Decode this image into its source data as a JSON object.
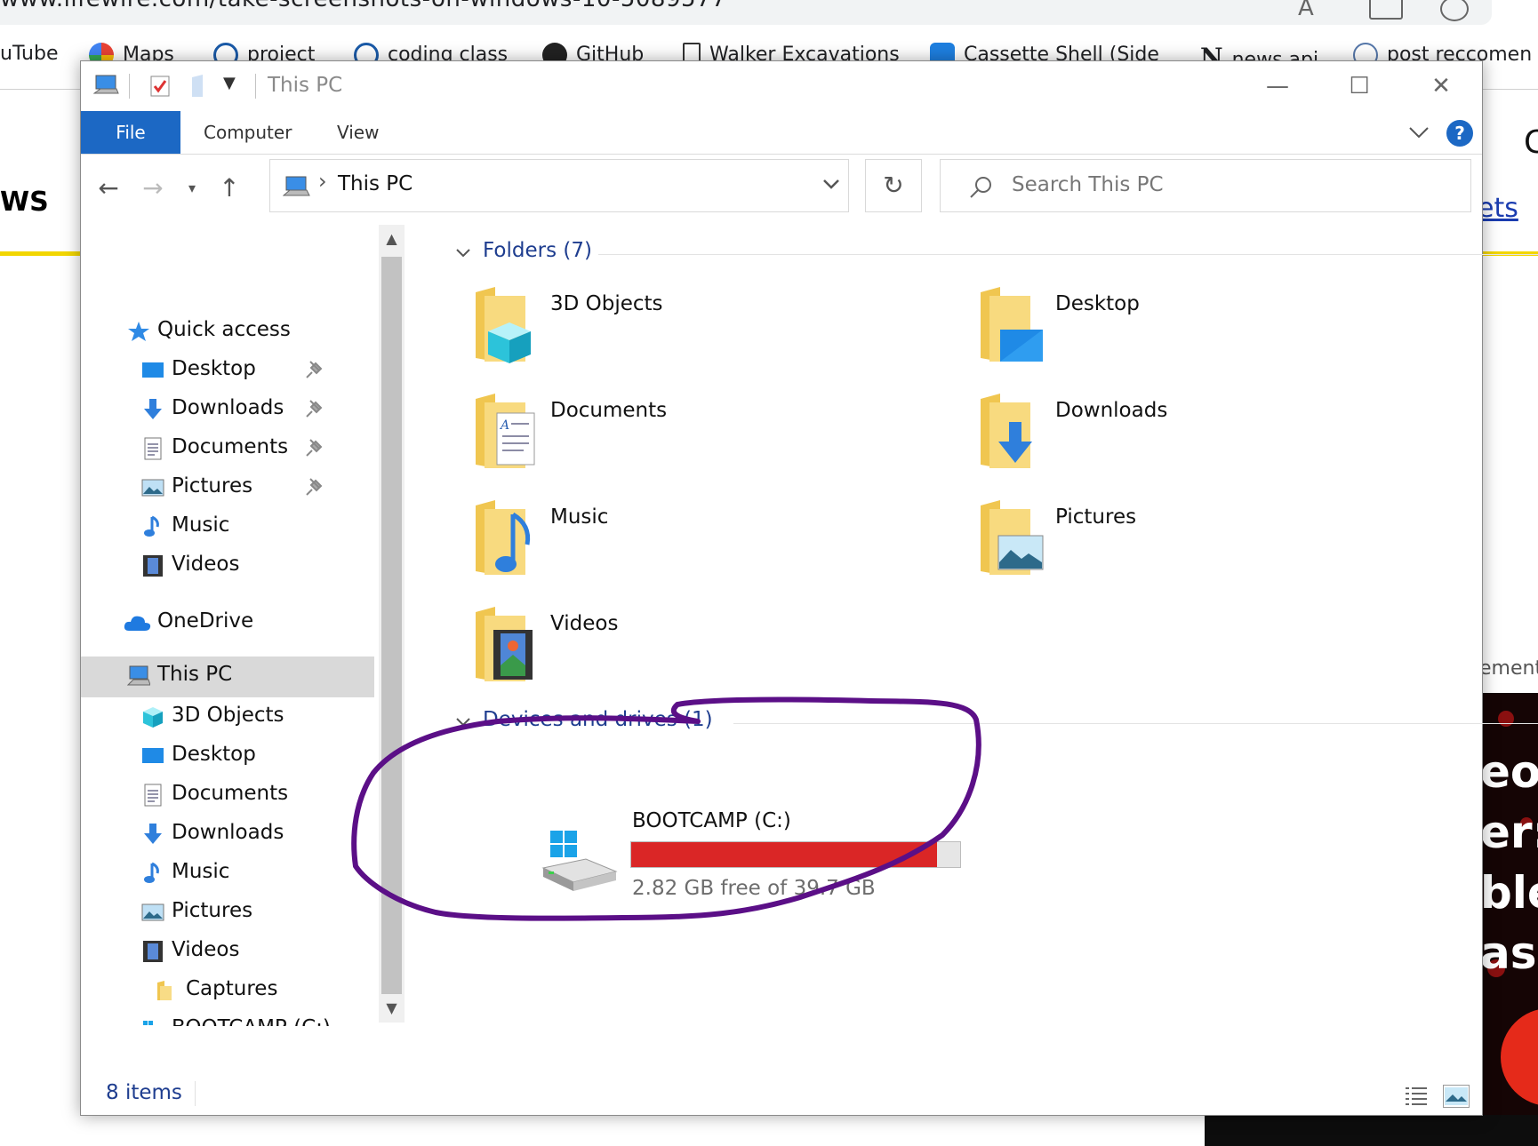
{
  "browser": {
    "url": "www.lifewire.com/take-screenshots-on-windows-10-5089577",
    "bookmarks": [
      "uTube",
      "Maps",
      "project",
      "coding class",
      "GitHub",
      "Walker Excavations",
      "Cassette Shell (Side",
      "news api",
      "post reccomen"
    ],
    "page_fragments": {
      "left_heading": "WS",
      "right_link": "ets",
      "right_letter": "C",
      "ad_label": "ement",
      "thumb_lines": [
        "eo",
        "er:",
        "ble",
        "asp"
      ]
    }
  },
  "explorer": {
    "title": "This PC",
    "ribbon_tabs": {
      "file": "File",
      "computer": "Computer",
      "view": "View"
    },
    "help_label": "?",
    "address": {
      "location": "This PC"
    },
    "search": {
      "placeholder": "Search This PC"
    },
    "nav": {
      "quick_access": "Quick access",
      "quick_items": [
        "Desktop",
        "Downloads",
        "Documents",
        "Pictures",
        "Music",
        "Videos"
      ],
      "onedrive": "OneDrive",
      "this_pc": "This PC",
      "pc_items": [
        "3D Objects",
        "Desktop",
        "Documents",
        "Downloads",
        "Music",
        "Pictures",
        "Videos",
        "Captures",
        "BOOTCAMP (C:)"
      ]
    },
    "folders_group": "Folders (7)",
    "folders": [
      "3D Objects",
      "Desktop",
      "Documents",
      "Downloads",
      "Music",
      "Pictures",
      "Videos"
    ],
    "devices_group": "Devices and drives (1)",
    "drive": {
      "name": "BOOTCAMP (C:)",
      "free_text": "2.82 GB free of 39.7 GB",
      "used_fraction": 0.929,
      "bar_color": "#da2626"
    },
    "status": {
      "items": "8 items"
    },
    "annotation_color": "#5b0f87"
  }
}
